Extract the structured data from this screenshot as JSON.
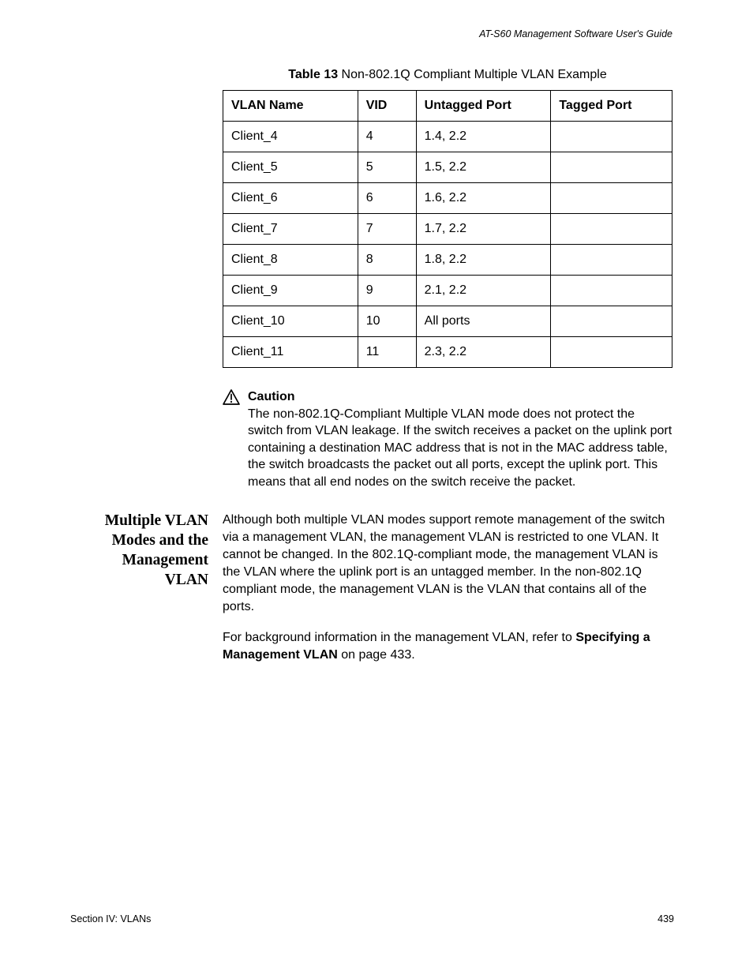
{
  "header": {
    "running": "AT-S60 Management Software User's Guide"
  },
  "table": {
    "caption_bold": "Table 13",
    "caption_rest": " Non-802.1Q Compliant Multiple VLAN Example",
    "headers": {
      "name": "VLAN Name",
      "vid": "VID",
      "untagged": "Untagged Port",
      "tagged": "Tagged Port"
    },
    "rows": [
      {
        "name": "Client_4",
        "vid": "4",
        "untagged": "1.4, 2.2",
        "tagged": ""
      },
      {
        "name": "Client_5",
        "vid": "5",
        "untagged": "1.5, 2.2",
        "tagged": ""
      },
      {
        "name": "Client_6",
        "vid": "6",
        "untagged": "1.6, 2.2",
        "tagged": ""
      },
      {
        "name": "Client_7",
        "vid": "7",
        "untagged": "1.7, 2.2",
        "tagged": ""
      },
      {
        "name": "Client_8",
        "vid": "8",
        "untagged": "1.8, 2.2",
        "tagged": ""
      },
      {
        "name": "Client_9",
        "vid": "9",
        "untagged": "2.1, 2.2",
        "tagged": ""
      },
      {
        "name": "Client_10",
        "vid": "10",
        "untagged": "All ports",
        "tagged": ""
      },
      {
        "name": "Client_11",
        "vid": "11",
        "untagged": "2.3, 2.2",
        "tagged": ""
      }
    ]
  },
  "caution": {
    "heading": "Caution",
    "body": "The non-802.1Q-Compliant Multiple VLAN mode does not protect the switch from VLAN leakage. If the switch receives a packet on the uplink port containing a destination MAC address that is not in the MAC address table, the switch broadcasts the packet out all ports, except the uplink port. This means that all end nodes on the switch receive the packet."
  },
  "section": {
    "side_heading": "Multiple VLAN Modes and the Management VLAN",
    "para1": "Although both multiple VLAN modes support remote management of the switch via a management VLAN, the management VLAN is restricted to one VLAN. It cannot be changed. In the 802.1Q-compliant mode, the management VLAN is the VLAN where the uplink port is an untagged member. In the non-802.1Q compliant mode, the management VLAN is the VLAN that contains all of the ports.",
    "para2_pre": "For background information in the management VLAN, refer to ",
    "para2_bold": "Specifying a Management VLAN",
    "para2_post": " on page 433."
  },
  "footer": {
    "left": "Section IV: VLANs",
    "right": "439"
  },
  "chart_data": {
    "type": "table",
    "title": "Table 13 Non-802.1Q Compliant Multiple VLAN Example",
    "columns": [
      "VLAN Name",
      "VID",
      "Untagged Port",
      "Tagged Port"
    ],
    "rows": [
      [
        "Client_4",
        4,
        "1.4, 2.2",
        ""
      ],
      [
        "Client_5",
        5,
        "1.5, 2.2",
        ""
      ],
      [
        "Client_6",
        6,
        "1.6, 2.2",
        ""
      ],
      [
        "Client_7",
        7,
        "1.7, 2.2",
        ""
      ],
      [
        "Client_8",
        8,
        "1.8, 2.2",
        ""
      ],
      [
        "Client_9",
        9,
        "2.1, 2.2",
        ""
      ],
      [
        "Client_10",
        10,
        "All ports",
        ""
      ],
      [
        "Client_11",
        11,
        "2.3, 2.2",
        ""
      ]
    ]
  }
}
